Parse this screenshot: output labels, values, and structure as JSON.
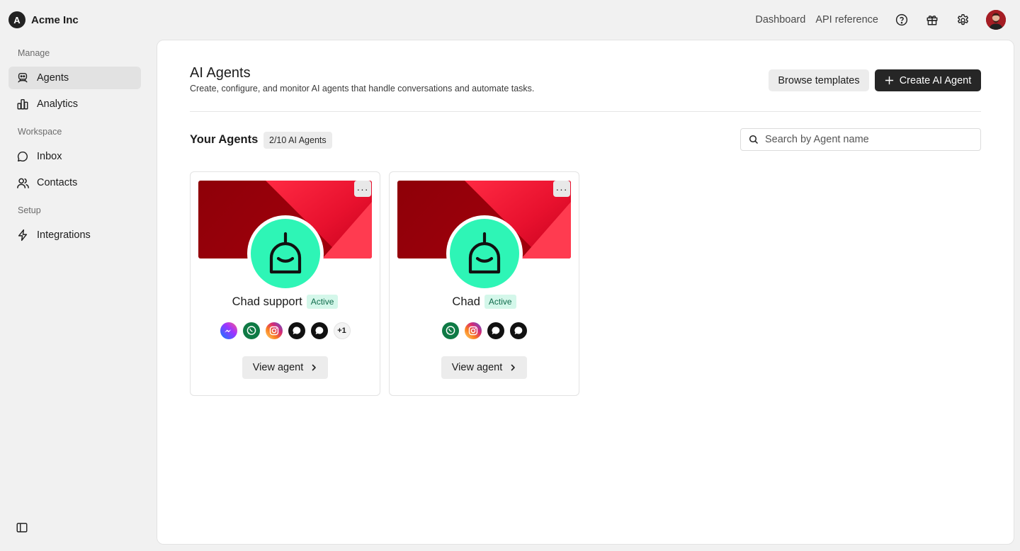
{
  "org": {
    "initial": "A",
    "name": "Acme Inc"
  },
  "topbar": {
    "links": [
      "Dashboard",
      "API reference"
    ],
    "icons": [
      "help-icon",
      "gift-icon",
      "settings-icon"
    ]
  },
  "sidebar": {
    "sections": [
      {
        "label": "Manage",
        "items": [
          {
            "label": "Agents",
            "icon": "robot-icon",
            "active": true
          },
          {
            "label": "Analytics",
            "icon": "bar-chart-icon"
          }
        ]
      },
      {
        "label": "Workspace",
        "items": [
          {
            "label": "Inbox",
            "icon": "chat-bubble-icon"
          },
          {
            "label": "Contacts",
            "icon": "users-icon"
          }
        ]
      },
      {
        "label": "Setup",
        "items": [
          {
            "label": "Integrations",
            "icon": "lightning-icon"
          }
        ]
      }
    ]
  },
  "page": {
    "title": "AI Agents",
    "subtitle": "Create, configure, and monitor AI agents that handle conversations and automate tasks.",
    "browse_label": "Browse templates",
    "create_label": "Create AI Agent"
  },
  "agents_section": {
    "title": "Your Agents",
    "count_badge": "2/10 AI Agents",
    "search_placeholder": "Search by Agent name"
  },
  "agents": [
    {
      "name": "Chad support",
      "status": "Active",
      "channels": [
        "messenger",
        "whatsapp",
        "instagram",
        "chat",
        "chat"
      ],
      "more_channels": "+1",
      "view_label": "View agent"
    },
    {
      "name": "Chad",
      "status": "Active",
      "channels": [
        "whatsapp",
        "instagram",
        "chat",
        "chat"
      ],
      "view_label": "View agent"
    }
  ],
  "colors": {
    "accent_dark": "#262626",
    "agent_avatar": "#2ef5b6",
    "banner_red": "#8e0008",
    "banner_pink": "#ff3b50",
    "status_bg": "#d4f7ea",
    "status_text": "#0f6b4b"
  }
}
